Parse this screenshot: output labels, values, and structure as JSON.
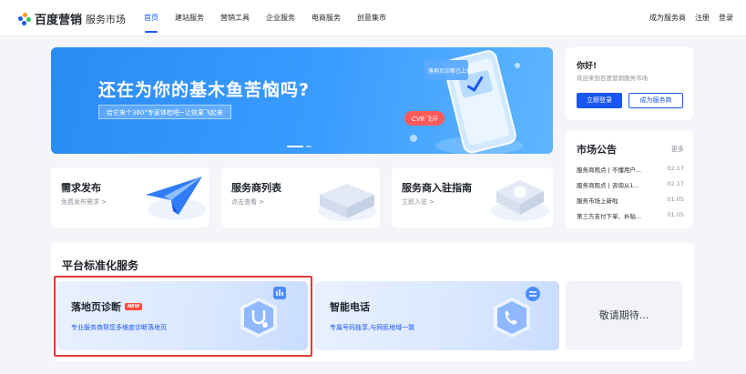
{
  "header": {
    "brand": "百度营销",
    "site_name": "服务市场",
    "nav": [
      "首页",
      "建站服务",
      "营销工具",
      "企业服务",
      "电商服务",
      "创意集市"
    ],
    "active_nav": "首页",
    "right_links": [
      "成为服务商",
      "注册",
      "登录"
    ]
  },
  "banner": {
    "title": "还在为你的基木鱼苦恼吗?",
    "subtitle": "给它来个360°专家体检吧~让效果飞起来",
    "phone_tag": "落地页诊断已上线!",
    "cvr_tag": "CVR飞升"
  },
  "login": {
    "greeting": "你好!",
    "welcome": "欢迎来到百度营销服务市场",
    "login_button": "立即登录",
    "provider_button": "成为服务商"
  },
  "notices": {
    "title": "市场公告",
    "more": "更多",
    "items": [
      {
        "text": "服务商观点 | 不懂用户...",
        "date": "02.17"
      },
      {
        "text": "服务商观点 | 咨询从1...",
        "date": "02.17"
      },
      {
        "text": "服务市场上新啦",
        "date": "01.05"
      },
      {
        "text": "第三方支付下单、补贴...",
        "date": "01.05"
      }
    ]
  },
  "features": [
    {
      "title": "需求发布",
      "sub": "免费发布需求 >"
    },
    {
      "title": "服务商列表",
      "sub": "点击查看 >"
    },
    {
      "title": "服务商入驻指南",
      "sub": "立即入驻 >"
    }
  ],
  "services": {
    "title": "平台标准化服务",
    "items": [
      {
        "title": "落地页诊断",
        "badge": "NEW",
        "desc": "专业服务商帮您多维度诊断落地页"
      },
      {
        "title": "智能电话",
        "desc": "专属号码独享,与网民地域一致"
      }
    ],
    "coming_soon": "敬请期待..."
  },
  "colors": {
    "accent": "#1a56f0",
    "banner": "#3a9cff",
    "highlight": "#e53935"
  }
}
